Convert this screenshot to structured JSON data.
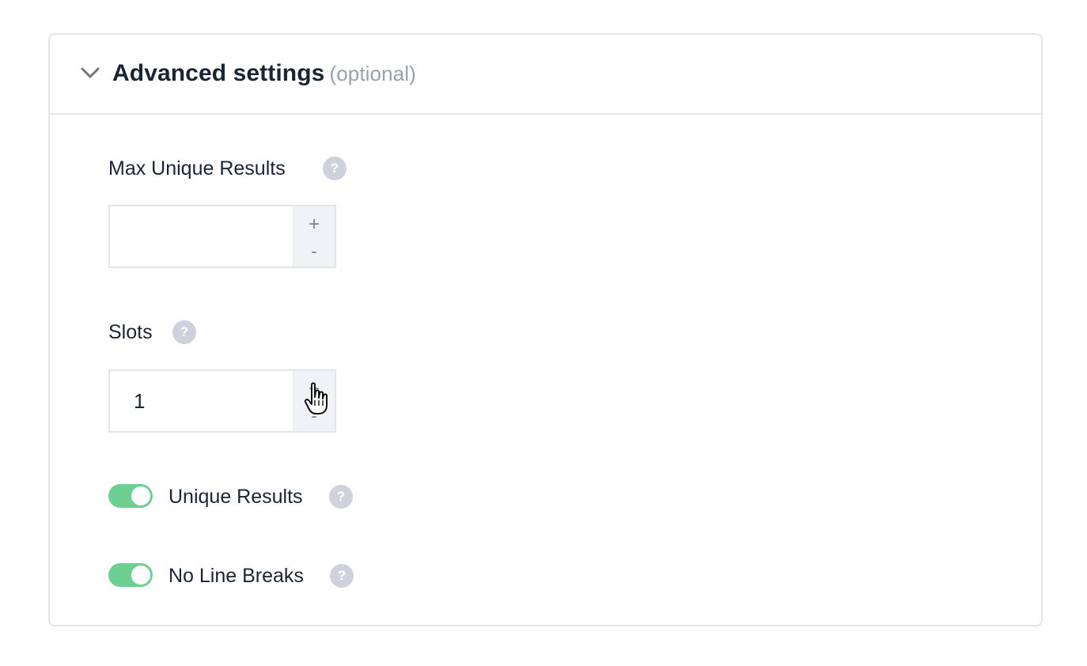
{
  "header": {
    "title": "Advanced settings",
    "optional": "(optional)"
  },
  "fields": {
    "max_unique_results": {
      "label": "Max Unique Results",
      "value": "",
      "increment": "+",
      "decrement": "-"
    },
    "slots": {
      "label": "Slots",
      "value": "1",
      "increment": "+",
      "decrement": "-"
    },
    "unique_results": {
      "label": "Unique Results",
      "enabled": true
    },
    "no_line_breaks": {
      "label": "No Line Breaks",
      "enabled": true
    }
  },
  "help_glyph": "?",
  "colors": {
    "toggle_on": "#6dcf91",
    "help_icon": "#cfd2dc",
    "border": "#e3e5ea",
    "text": "#1b2434",
    "muted": "#9aa0ab"
  },
  "icons": {
    "collapse": "chevron-down-icon",
    "help": "question-mark-icon",
    "cursor": "hand-pointer-cursor"
  }
}
